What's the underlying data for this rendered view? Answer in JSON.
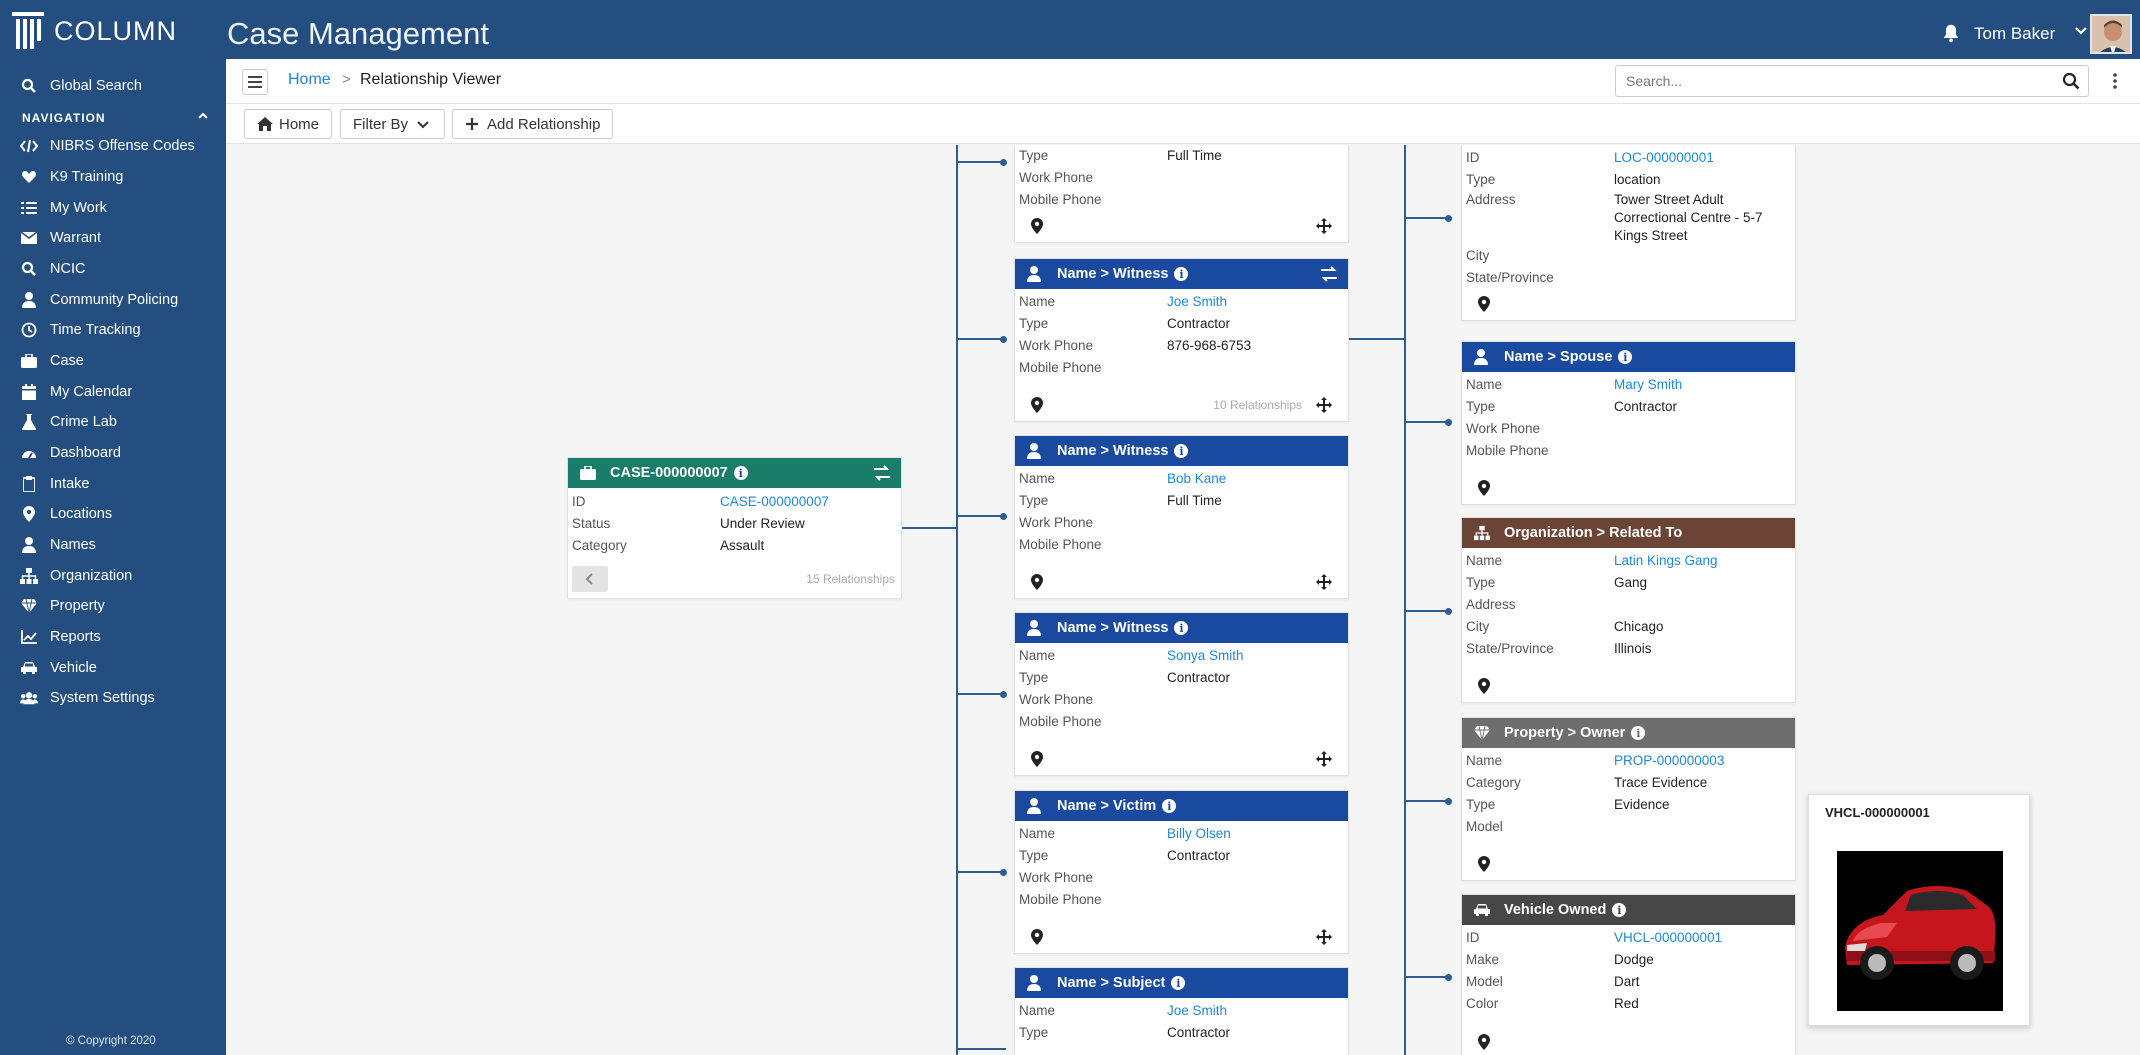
{
  "app": {
    "logo_text": "COLUMN",
    "title": "Case Management"
  },
  "user": {
    "name": "Tom Baker"
  },
  "sidebar": {
    "global_search": "Global Search",
    "nav_header": "NAVIGATION",
    "items": [
      {
        "label": "NIBRS Offense Codes",
        "icon": "code-icon"
      },
      {
        "label": "K9 Training",
        "icon": "heart-icon"
      },
      {
        "label": "My Work",
        "icon": "list-icon"
      },
      {
        "label": "Warrant",
        "icon": "envelope-icon"
      },
      {
        "label": "NCIC",
        "icon": "search-icon"
      },
      {
        "label": "Community Policing",
        "icon": "person-icon"
      },
      {
        "label": "Time Tracking",
        "icon": "clock-icon"
      },
      {
        "label": "Case",
        "icon": "briefcase-icon"
      },
      {
        "label": "My Calendar",
        "icon": "calendar-icon"
      },
      {
        "label": "Crime Lab",
        "icon": "flask-icon"
      },
      {
        "label": "Dashboard",
        "icon": "gauge-icon"
      },
      {
        "label": "Intake",
        "icon": "clipboard-icon"
      },
      {
        "label": "Locations",
        "icon": "map-pin-icon"
      },
      {
        "label": "Names",
        "icon": "person-icon"
      },
      {
        "label": "Organization",
        "icon": "sitemap-icon"
      },
      {
        "label": "Property",
        "icon": "diamond-icon"
      },
      {
        "label": "Reports",
        "icon": "chart-icon"
      },
      {
        "label": "Vehicle",
        "icon": "car-icon"
      },
      {
        "label": "System Settings",
        "icon": "users-icon"
      }
    ],
    "copyright": "© Copyright 2020"
  },
  "breadcrumb": {
    "home": "Home",
    "separator": ">",
    "current": "Relationship Viewer"
  },
  "search": {
    "placeholder": "Search..."
  },
  "toolbar": {
    "home": "Home",
    "filter": "Filter By",
    "add": "Add Relationship"
  },
  "case_card": {
    "title": "CASE-000000007",
    "rows": [
      {
        "label": "ID",
        "value": "CASE-000000007"
      },
      {
        "label": "Status",
        "value": "Under Review"
      },
      {
        "label": "Category",
        "value": "Assault"
      }
    ],
    "relationships": "15 Relationships"
  },
  "mid_cards": [
    {
      "title": "",
      "rows": [
        {
          "label": "Type",
          "value": "Full Time"
        },
        {
          "label": "Work Phone",
          "value": ""
        },
        {
          "label": "Mobile Phone",
          "value": ""
        }
      ]
    },
    {
      "title": "Name > Witness",
      "rows": [
        {
          "label": "Name",
          "value": "Joe Smith"
        },
        {
          "label": "Type",
          "value": "Contractor"
        },
        {
          "label": "Work Phone",
          "value": "876-968-6753"
        },
        {
          "label": "Mobile Phone",
          "value": ""
        }
      ],
      "relationships": "10 Relationships"
    },
    {
      "title": "Name > Witness",
      "rows": [
        {
          "label": "Name",
          "value": "Bob Kane"
        },
        {
          "label": "Type",
          "value": "Full Time"
        },
        {
          "label": "Work Phone",
          "value": ""
        },
        {
          "label": "Mobile Phone",
          "value": ""
        }
      ]
    },
    {
      "title": "Name > Witness",
      "rows": [
        {
          "label": "Name",
          "value": "Sonya Smith"
        },
        {
          "label": "Type",
          "value": "Contractor"
        },
        {
          "label": "Work Phone",
          "value": ""
        },
        {
          "label": "Mobile Phone",
          "value": ""
        }
      ]
    },
    {
      "title": "Name > Victim",
      "rows": [
        {
          "label": "Name",
          "value": "Billy Olsen"
        },
        {
          "label": "Type",
          "value": "Contractor"
        },
        {
          "label": "Work Phone",
          "value": ""
        },
        {
          "label": "Mobile Phone",
          "value": ""
        }
      ]
    },
    {
      "title": "Name > Subject",
      "rows": [
        {
          "label": "Name",
          "value": "Joe Smith"
        },
        {
          "label": "Type",
          "value": "Contractor"
        }
      ]
    }
  ],
  "right_cards": [
    {
      "title": "",
      "rows": [
        {
          "label": "ID",
          "value": "LOC-000000001"
        },
        {
          "label": "Type",
          "value": "location"
        },
        {
          "label": "Address",
          "value": "Tower Street Adult"
        },
        {
          "label": "",
          "value": "Correctional Centre - 5-7"
        },
        {
          "label": "",
          "value": "Kings Street"
        },
        {
          "label": "City",
          "value": ""
        },
        {
          "label": "State/Province",
          "value": ""
        }
      ]
    },
    {
      "title": "Name > Spouse",
      "rows": [
        {
          "label": "Name",
          "value": "Mary Smith"
        },
        {
          "label": "Type",
          "value": "Contractor"
        },
        {
          "label": "Work Phone",
          "value": ""
        },
        {
          "label": "Mobile Phone",
          "value": ""
        }
      ]
    },
    {
      "title": "Organization > Related To",
      "rows": [
        {
          "label": "Name",
          "value": "Latin Kings Gang"
        },
        {
          "label": "Type",
          "value": "Gang"
        },
        {
          "label": "Address",
          "value": ""
        },
        {
          "label": "City",
          "value": "Chicago"
        },
        {
          "label": "State/Province",
          "value": "Illinois"
        }
      ]
    },
    {
      "title": "Property > Owner",
      "rows": [
        {
          "label": "Name",
          "value": "PROP-000000003"
        },
        {
          "label": "Category",
          "value": "Trace Evidence"
        },
        {
          "label": "Type",
          "value": "Evidence"
        },
        {
          "label": "Model",
          "value": ""
        }
      ]
    },
    {
      "title": "Vehicle Owned",
      "rows": [
        {
          "label": "ID",
          "value": "VHCL-000000001"
        },
        {
          "label": "Make",
          "value": "Dodge"
        },
        {
          "label": "Model",
          "value": "Dart"
        },
        {
          "label": "Color",
          "value": "Red"
        }
      ]
    }
  ],
  "vehicle_popup": {
    "title": "VHCL-000000001"
  },
  "colors": {
    "brand": "#244e80",
    "card_blue": "#1a4a9f",
    "card_green": "#1a7d6a",
    "card_brown": "#6b4436",
    "card_gray": "#6e6e6e",
    "card_dark": "#474747",
    "link": "#1e88d6"
  }
}
